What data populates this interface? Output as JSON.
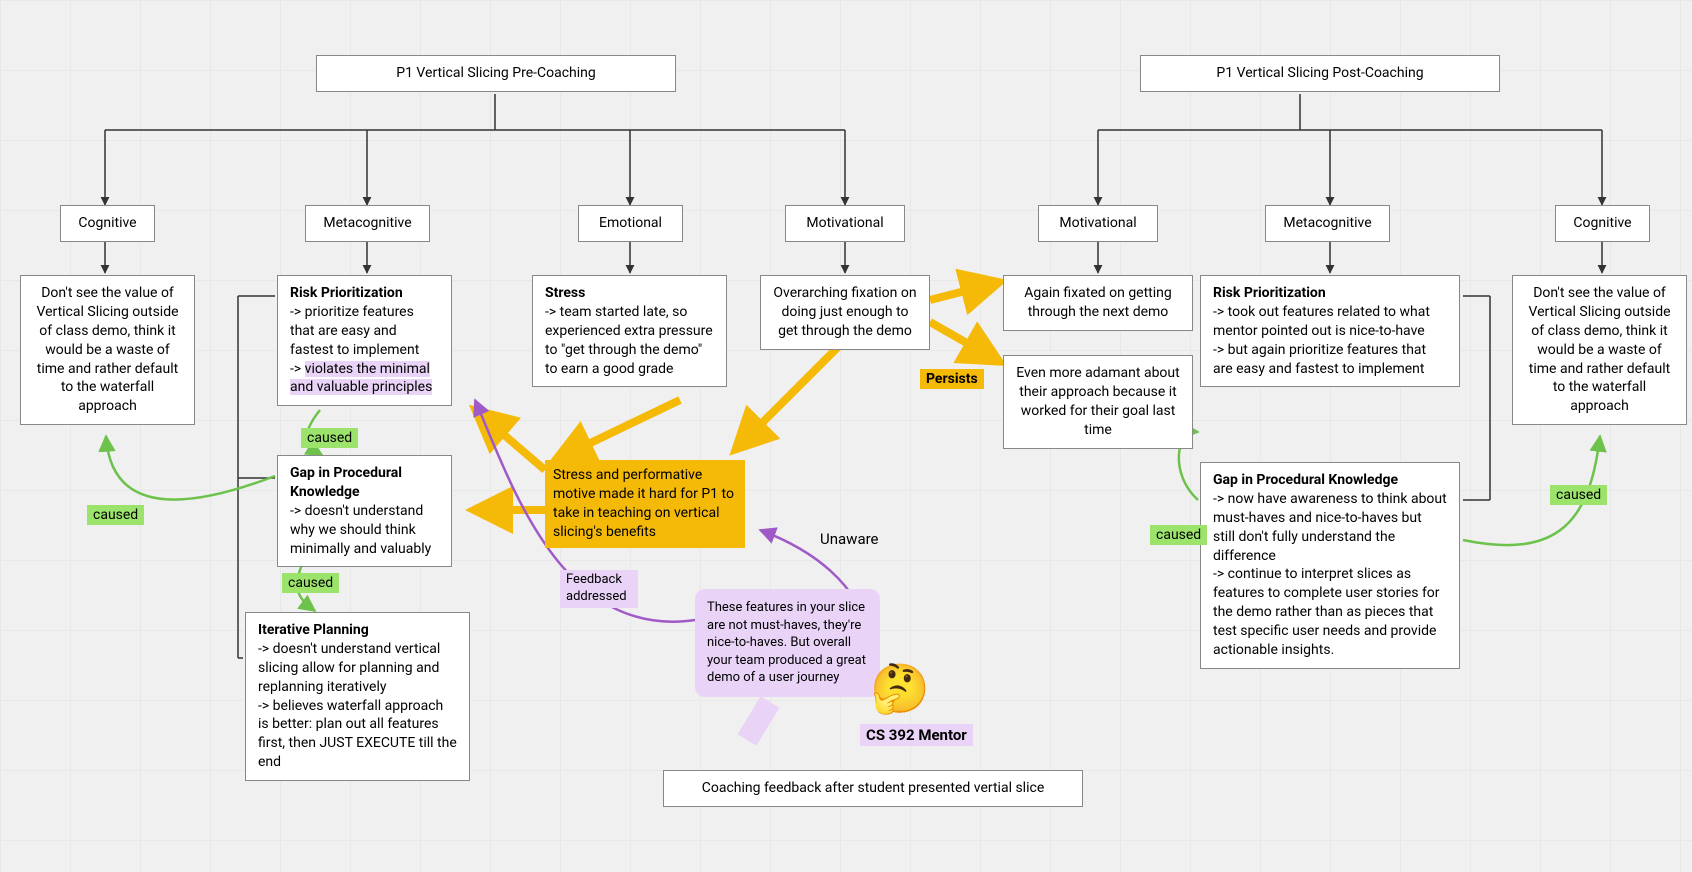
{
  "titles": {
    "pre": "P1 Vertical Slicing Pre-Coaching",
    "post": "P1 Vertical Slicing Post-Coaching"
  },
  "categories": {
    "cognitive": "Cognitive",
    "metacognitive": "Metacognitive",
    "emotional": "Emotional",
    "motivational": "Motivational"
  },
  "pre": {
    "cognitive_text": "Don't see the value of Vertical Slicing outside of class demo, think it would be a waste of time and rather default to the waterfall approach",
    "risk_title": "Risk Prioritization",
    "risk_line1": "-> prioritize features that are easy and fastest to implement",
    "risk_line2_prefix": "-> ",
    "risk_line2_hl": "violates the minimal and valuable principles",
    "gap_title": "Gap in Procedural Knowledge",
    "gap_body": "-> doesn't understand why we should think minimally and valuably",
    "iter_title": "Iterative Planning",
    "iter_line1": "-> doesn't understand vertical slicing allow for planning and replanning iteratively",
    "iter_line2": "-> believes waterfall approach is better: plan out all features first, then JUST EXECUTE till the end",
    "stress_title": "Stress",
    "stress_body": "-> team started late, so experienced extra pressure to \"get through the demo\" to earn a good grade",
    "motivational_body": "Overarching fixation on doing just enough to get through the demo"
  },
  "post": {
    "motivational1": "Again fixated on getting through the next demo",
    "motivational2": "Even more adamant about their approach because it worked for their goal last time",
    "risk_title": "Risk Prioritization",
    "risk_line1": "-> took out features related to what mentor pointed out is nice-to-have",
    "risk_line2": "-> but again prioritize features that are easy and fastest to implement",
    "gap_title": "Gap in Procedural Knowledge",
    "gap_body1": "-> now have awareness to think about must-haves and nice-to-haves but still don't fully understand the difference",
    "gap_body2": "-> continue to interpret slices as features to complete user stories for the demo rather than as pieces that test specific user needs and provide actionable insights.",
    "cognitive_text": "Don't see the value of Vertical Slicing outside of class demo, think it would be a waste of time and rather default to the waterfall approach"
  },
  "labels": {
    "caused": "caused",
    "persists": "Persists",
    "unaware": "Unaware",
    "feedback_addressed": "Feedback addressed",
    "mentor": "CS 392 Mentor"
  },
  "callout": "Stress and performative motive made it hard for P1 to take in teaching on vertical slicing's benefits",
  "speech": "These features in your slice are not must-haves, they're nice-to-haves. But overall your team produced a great demo of a user journey",
  "feedback_box": "Coaching feedback after student presented vertial slice",
  "emoji": "🤔"
}
